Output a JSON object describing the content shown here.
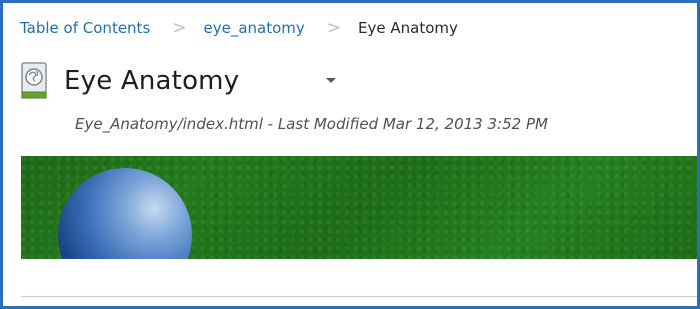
{
  "breadcrumb": {
    "items": [
      "Table of Contents",
      "eye_anatomy"
    ],
    "current": "Eye Anatomy",
    "separator": ">"
  },
  "header": {
    "title": "Eye Anatomy",
    "icon": "web-page-icon",
    "menu_icon": "chevron-down-icon"
  },
  "meta": {
    "text": "Eye_Anatomy/index.html - Last Modified Mar 12, 2013 3:52 PM"
  },
  "colors": {
    "frame_border": "#2a6fb7",
    "link": "#1f6fb5",
    "banner_green": "#1f721a",
    "sphere_blue": "#3b6fb9"
  }
}
